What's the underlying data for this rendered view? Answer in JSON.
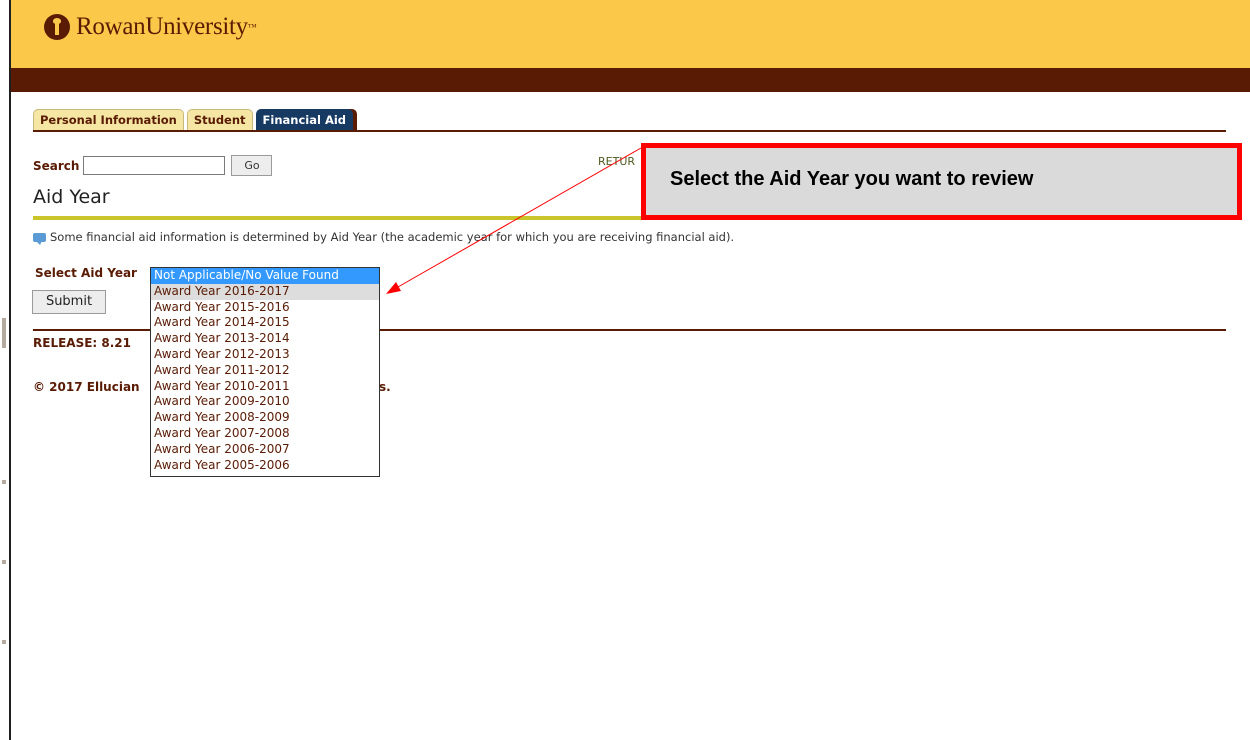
{
  "header": {
    "brand": "RowanUniversity",
    "tm": "™",
    "colors": {
      "gold": "#fcc849",
      "brown": "#5a1b04"
    }
  },
  "tabs": [
    {
      "label": "Personal Information",
      "active": false
    },
    {
      "label": "Student",
      "active": false
    },
    {
      "label": "Financial Aid",
      "active": true
    }
  ],
  "search": {
    "label": "Search",
    "value": "",
    "go_label": "Go"
  },
  "return_link": "RETUR",
  "page_title": "Aid Year",
  "info_text": "Some financial aid information is determined by Aid Year (the academic year for which you are receiving financial aid).",
  "form": {
    "select_label": "Select Aid Year",
    "submit_label": "Submit",
    "selected_value": "Not Applicable/No Value Found",
    "options": [
      "Not Applicable/No Value Found",
      "Award Year 2016-2017",
      "Award Year 2015-2016",
      "Award Year 2014-2015",
      "Award Year 2013-2014",
      "Award Year 2012-2013",
      "Award Year 2011-2012",
      "Award Year 2010-2011",
      "Award Year 2009-2010",
      "Award Year 2008-2009",
      "Award Year 2007-2008",
      "Award Year 2006-2007",
      "Award Year 2005-2006"
    ],
    "hovered_option": "Award Year 2016-2017"
  },
  "footer": {
    "release": "RELEASE: 8.21",
    "copyright": "© 2017 Ellucian",
    "copyright_tail": "s."
  },
  "callout": {
    "text": "Select the Aid Year you want to review",
    "border_color": "#ff0000"
  }
}
